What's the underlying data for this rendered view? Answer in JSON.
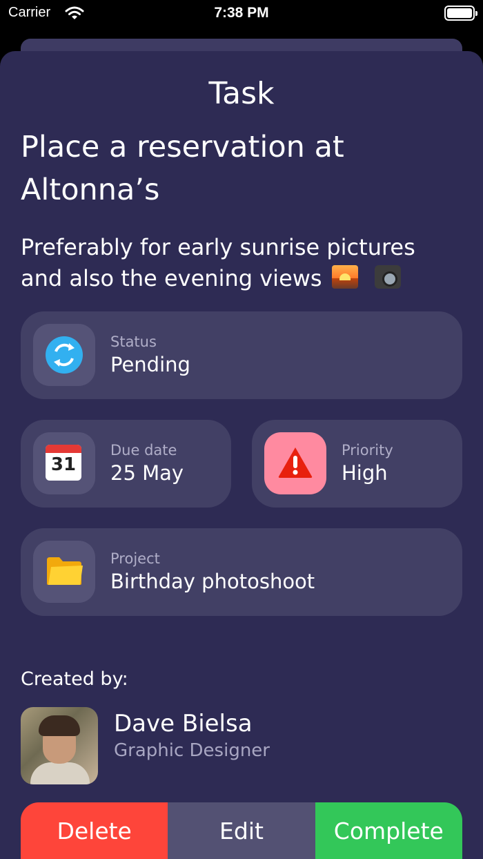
{
  "status_bar": {
    "carrier": "Carrier",
    "time": "7:38 PM"
  },
  "sheet": {
    "title": "Task"
  },
  "task": {
    "title": "Place a reservation at Altonna’s",
    "description": "Preferably for early sunrise pictures and also the evening views"
  },
  "status_card": {
    "label": "Status",
    "value": "Pending",
    "icon": "refresh-icon"
  },
  "due_card": {
    "label": "Due date",
    "value": "25  May",
    "icon": "calendar-icon",
    "calendar_day": "31"
  },
  "priority_card": {
    "label": "Priority",
    "value": "High",
    "icon": "warning-icon",
    "icon_bg": "#ff8aa0"
  },
  "project_card": {
    "label": "Project",
    "value": "Birthday photoshoot",
    "icon": "folder-icon"
  },
  "creator": {
    "section_label": "Created by:",
    "name": "Dave Bielsa",
    "role": "Graphic Designer"
  },
  "actions": {
    "delete": "Delete",
    "edit": "Edit",
    "complete": "Complete"
  },
  "colors": {
    "background": "#2e2b54",
    "card": "#424065",
    "delete": "#fe453a",
    "edit": "#535173",
    "complete": "#33c759"
  }
}
